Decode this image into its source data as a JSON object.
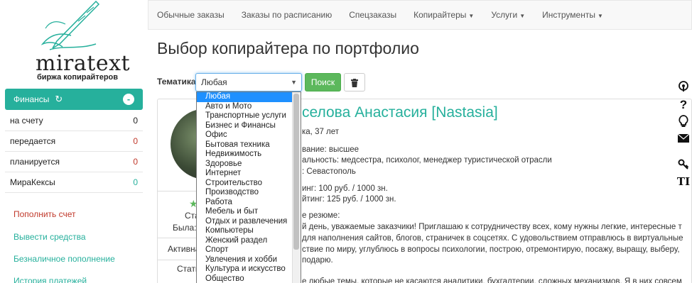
{
  "logo": {
    "word": "miratext",
    "subtitle": "биржа копирайтеров"
  },
  "finance": {
    "title": "Финансы",
    "collapse_symbol": "-",
    "rows": [
      {
        "label": "на счету",
        "value": "0"
      },
      {
        "label": "передается",
        "value": "0"
      },
      {
        "label": "планируется",
        "value": "0"
      },
      {
        "label": "МираКексы",
        "value": "0"
      }
    ]
  },
  "side_links": [
    {
      "label": "Пополнить счет",
      "color": "#c0392b"
    },
    {
      "label": "Вывести средства",
      "color": "#26b09c"
    },
    {
      "label": "Безналичное пополнение",
      "color": "#26b09c"
    },
    {
      "label": "История платежей",
      "color": "#26b09c"
    }
  ],
  "nav": {
    "items": [
      "Обычные заказы",
      "Заказы по расписанию",
      "Спецзаказы",
      "Копирайтеры",
      "Услуги",
      "Инструменты"
    ]
  },
  "page_title": "Выбор копирайтера по портфолио",
  "filter": {
    "label": "Тематика",
    "selected": "Любая",
    "search_label": "Поиск",
    "options": [
      "Любая",
      "Авто и Мото",
      "Транспортные услуги",
      "Бизнес и Финансы",
      "Офис",
      "Бытовая техника",
      "Недвижимость",
      "Здоровье",
      "Интернет",
      "Строительство",
      "Производство",
      "Работа",
      "Мебель и быт",
      "Отдых и развлечения",
      "Компьютеры",
      "Женский раздел",
      "Спорт",
      "Увлечения и хобби",
      "Культура и искусство",
      "Общество"
    ]
  },
  "profile": {
    "name": "селова Анастасия [Nastasia]",
    "age": "ка, 37 лет",
    "education": "вание: высшее",
    "profession": "альность: медсестра, психолог, менеджер туристической отрасли",
    "city": ": Севастополь",
    "rate1": "инг: 100 руб. / 1000 зн.",
    "rate2": "йтинг: 125 руб. / 1000 зн.",
    "resume_label": "е резюме:",
    "resume1": "й день, уважаемые заказчики! Приглашаю к сотрудничеству всех, кому нужны легкие, интересные т",
    "resume2": "для наполнения сайтов, блогов, страничек в соцсетях. С удовольствием отправлюсь в виртуальные",
    "resume3": "ствие по миру, углублюсь в вопросы психологии, построю, отремонтирую, посажу, выращу, выберу,",
    "resume4": "подарю.",
    "resume5": "е любые темы, которые не касаются аналитики, бухгалтерии, сложных механизмов. Я в них совсем",
    "left_stat": "Ста",
    "left_was": "Была:",
    "left_active": "Активна",
    "left_stat2": "Стати"
  },
  "right_icons": [
    "podcast-icon",
    "question-icon",
    "lightbulb-icon",
    "envelope-icon",
    "key-icon",
    "text-icon"
  ],
  "right_text": "TI"
}
